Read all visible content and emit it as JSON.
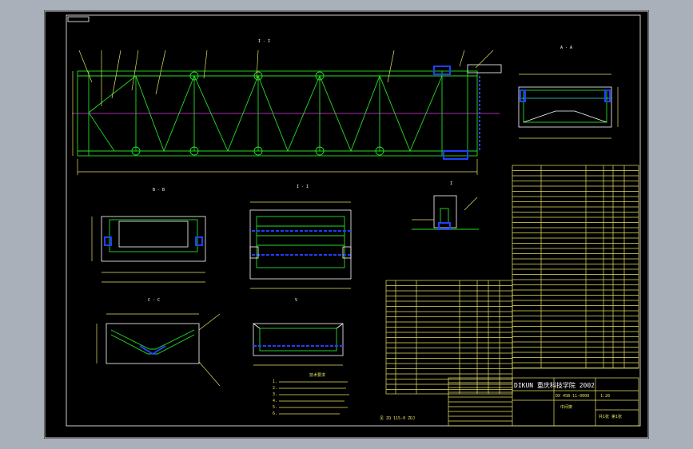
{
  "colors": {
    "background_outer": "#aab0ba",
    "sheet": "#000000",
    "frame": "#ffffff",
    "outline": "#22e022",
    "dimension": "#e8e060",
    "centerline": "#e040e0",
    "hidden": "#2040ff"
  },
  "views": {
    "main": {
      "label": "I - I"
    },
    "section_aa": {
      "label": "A - A"
    },
    "section_bb": {
      "label": "B - B"
    },
    "section_ii": {
      "label": "I - I"
    },
    "detail": {
      "label": "I"
    },
    "section_cc": {
      "label": "C - C"
    },
    "section_vv": {
      "label": "V"
    }
  },
  "notes": {
    "title": "技术要求",
    "items": [
      "1.",
      "2.",
      "3.",
      "4.",
      "5.",
      "6."
    ]
  },
  "ref_note": "见 ZQ 115-0 ZDJ",
  "title_block": {
    "school": "DIKUN 重庆科技学院 2002",
    "drawing_no": "DX 45B-11-0000",
    "part_name": "中间架",
    "scale": "1:20",
    "sheet_info": "共1张 第1张"
  }
}
